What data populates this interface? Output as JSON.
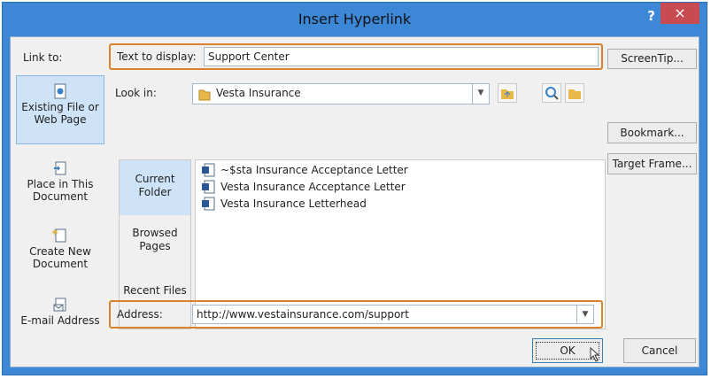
{
  "window": {
    "title": "Insert Hyperlink",
    "help": "?",
    "close": "×"
  },
  "link_to": {
    "label": "Link to:",
    "items": [
      {
        "label": "Existing File or Web Page",
        "active": true
      },
      {
        "label": "Place in This Document"
      },
      {
        "label": "Create New Document"
      },
      {
        "label": "E-mail Address"
      }
    ]
  },
  "text_to_display": {
    "label": "Text to display:",
    "value": "Support Center"
  },
  "look_in": {
    "label": "Look in:",
    "value": "Vesta Insurance"
  },
  "subnav": [
    {
      "label": "Current Folder",
      "active": true
    },
    {
      "label": "Browsed Pages"
    },
    {
      "label": "Recent Files"
    }
  ],
  "files": [
    "~$sta Insurance Acceptance Letter",
    "Vesta Insurance Acceptance Letter",
    "Vesta Insurance Letterhead"
  ],
  "address": {
    "label": "Address:",
    "value": "http://www.vestainsurance.com/support"
  },
  "buttons": {
    "screentip": "ScreenTip...",
    "bookmark": "Bookmark...",
    "target_frame": "Target Frame...",
    "ok": "OK",
    "cancel": "Cancel"
  },
  "colors": {
    "accent": "#3c87d6",
    "highlight": "#d9822b",
    "close": "#c74b50"
  }
}
